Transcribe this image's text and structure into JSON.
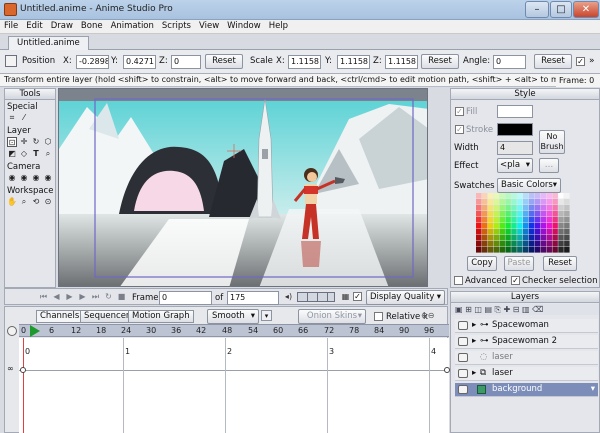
{
  "window": {
    "title": "Untitled.anime - Anime Studio Pro",
    "minimize": "–",
    "maximize": "□",
    "close": "✕"
  },
  "menu": [
    "File",
    "Edit",
    "Draw",
    "Bone",
    "Animation",
    "Scripts",
    "View",
    "Window",
    "Help"
  ],
  "document_tab": "Untitled.anime",
  "tool_options": {
    "position_label": "Position",
    "x_label": "X:",
    "x_value": "-0.2898",
    "y_label": "Y:",
    "y_value": "0.4271",
    "z_label": "Z:",
    "z_value": "0",
    "reset1": "Reset",
    "scale_label": "Scale",
    "sx_label": "X:",
    "sx_value": "1.1158",
    "sy_label": "Y:",
    "sy_value": "1.1158",
    "sz_label": "Z:",
    "sz_value": "1.1158",
    "reset2": "Reset",
    "angle_label": "Angle:",
    "angle_value": "0",
    "reset3": "Reset"
  },
  "status": {
    "message": "Transform entire layer (hold <shift> to constrain, <alt> to move forward and back, <ctrl/cmd> to edit motion path, <shift> + <alt> to move in",
    "frame_label": "Frame: 0"
  },
  "tools": {
    "header": "Tools",
    "sections": [
      "Special",
      "Layer",
      "Camera",
      "Workspace"
    ]
  },
  "playbar": {
    "frame_label": "Frame",
    "frame_value": "0",
    "of_label": "of",
    "total_frames": "175",
    "display_quality": "Display Quality"
  },
  "timeline": {
    "tabs": [
      "Channels",
      "Sequencer",
      "Motion Graph"
    ],
    "interpolation": "Smooth",
    "onion_skins": "Onion Skins",
    "relative_keys": "Relative k",
    "ruler": [
      "0",
      "6",
      "12",
      "18",
      "24",
      "30",
      "36",
      "42",
      "48",
      "54",
      "60",
      "66",
      "72",
      "78",
      "84",
      "90",
      "96"
    ],
    "seconds": [
      "0",
      "1",
      "2",
      "3",
      "4"
    ]
  },
  "style": {
    "header": "Style",
    "fill_label": "Fill",
    "stroke_label": "Stroke",
    "width_label": "Width",
    "width_value": "4",
    "no_brush": "No Brush",
    "effect_label": "Effect",
    "effect_value": "<pla",
    "swatches_label": "Swatches",
    "swatches_value": "Basic Colors",
    "copy": "Copy",
    "paste": "Paste",
    "reset": "Reset",
    "advanced": "Advanced",
    "checker_selection": "Checker selection",
    "fill_color": "#ffffff",
    "stroke_color": "#000000"
  },
  "layers": {
    "header": "Layers",
    "items": [
      {
        "name": "Spacewoman",
        "icon": "bone-icon",
        "expanded": false,
        "selected": false
      },
      {
        "name": "Spacewoman 2",
        "icon": "bone-icon",
        "expanded": false,
        "selected": false
      },
      {
        "name": "laser",
        "icon": "vector-icon",
        "expanded": false,
        "selected": false
      },
      {
        "name": "laser",
        "icon": "group-icon",
        "expanded": false,
        "selected": false
      },
      {
        "name": "background",
        "icon": "image-icon",
        "expanded": false,
        "selected": true
      }
    ]
  }
}
